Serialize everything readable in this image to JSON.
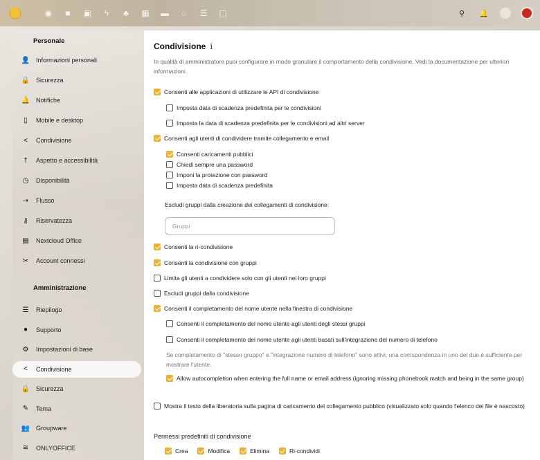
{
  "topbar": {
    "apps": [
      "dashboard-icon",
      "folder-icon",
      "photos-icon",
      "activity-icon",
      "contacts-icon",
      "calendar-icon",
      "mail-icon",
      "talk-icon",
      "tasks-icon",
      "notes-icon"
    ],
    "right": [
      "search-icon",
      "notifications-icon",
      "contacts-menu-icon",
      "user-avatar"
    ]
  },
  "sidebar": {
    "personal_heading": "Personale",
    "personal": [
      {
        "label": "Informazioni personali",
        "icon": "user-icon",
        "glyph": "👤"
      },
      {
        "label": "Sicurezza",
        "icon": "lock-icon",
        "glyph": "🔒"
      },
      {
        "label": "Notifiche",
        "icon": "bell-icon",
        "glyph": "🔔"
      },
      {
        "label": "Mobile e desktop",
        "icon": "phone-icon",
        "glyph": "▯"
      },
      {
        "label": "Condivisione",
        "icon": "share-icon",
        "glyph": "<"
      },
      {
        "label": "Aspetto e accessibilità",
        "icon": "accessibility-icon",
        "glyph": "†"
      },
      {
        "label": "Disponibilità",
        "icon": "clock-icon",
        "glyph": "◷"
      },
      {
        "label": "Flusso",
        "icon": "flow-icon",
        "glyph": "⇢"
      },
      {
        "label": "Riservatezza",
        "icon": "key-icon",
        "glyph": "⚷"
      },
      {
        "label": "Nextcloud Office",
        "icon": "office-icon",
        "glyph": "▤"
      },
      {
        "label": "Account connessi",
        "icon": "connected-icon",
        "glyph": "✂"
      }
    ],
    "admin_heading": "Amministrazione",
    "admin": [
      {
        "label": "Riepilogo",
        "icon": "list-icon",
        "glyph": "☰"
      },
      {
        "label": "Supporto",
        "icon": "support-icon",
        "glyph": "●"
      },
      {
        "label": "Impostazioni di base",
        "icon": "gear-icon",
        "glyph": "⚙"
      },
      {
        "label": "Condivisione",
        "icon": "share-icon",
        "glyph": "<",
        "active": true
      },
      {
        "label": "Sicurezza",
        "icon": "lock-icon",
        "glyph": "🔒"
      },
      {
        "label": "Tema",
        "icon": "brush-icon",
        "glyph": "✎"
      },
      {
        "label": "Groupware",
        "icon": "group-icon",
        "glyph": "👥"
      },
      {
        "label": "ONLYOFFICE",
        "icon": "onlyoffice-icon",
        "glyph": "≋"
      }
    ]
  },
  "main": {
    "title": "Condivisione",
    "info_glyph": "i",
    "description": "In qualità di amministratore puoi configurare in modo granulare il comportamento della condivisione. Vedi la documentazione per ulteriori informazioni.",
    "options": {
      "api": "Consenti alle applicazioni di utilizzare le API di condivisione",
      "default_expire": "Imposta data di scadenza predefinita per le condivisioni",
      "remote_expire": "Imposta la data di scadenza predefinita per le condivisioni ad altri server",
      "links": "Consenti agli utenti di condividere tramite collegamento e email",
      "public_upload": "Consenti caricamenti pubblici",
      "ask_password": "Chiedi sempre una password",
      "enforce_password": "Imponi la protezione con password",
      "link_expire": "Imposta data di scadenza predefinita",
      "exclude_groups_label": "Escludi gruppi dalla creazione dei collegamenti di condivisione:",
      "groups_placeholder": "Gruppi",
      "reshare": "Consenti la ri-condivisione",
      "group_share": "Consenti la condivisione con gruppi",
      "restrict_groups": "Limita gli utenti a condividere solo con gli utenti nei loro gruppi",
      "exclude_groups": "Escludi gruppi dalla condivisione",
      "autocomplete": "Consenti il completamento del nome utente nella finestra di condivisione",
      "autocomplete_groups": "Consenti il completamento del nome utente agli utenti degli stessi gruppi",
      "autocomplete_phone": "Consenti il completamento del nome utente agli utenti basati sull'integrazione del numero di telefono",
      "autocomplete_note": "Se completamento di \"stesso gruppo\" e \"integrazione numero di telefono\" sono attivi, una corrispondenza in uno dei due è sufficiente per mostrare l'utente.",
      "full_match": "Allow autocompletion when entering the full name or email address (ignoring missing phonebook match and being in the same group)",
      "disclaimer": "Mostra il testo della liberatoria sulla pagina di caricamento del collegamento pubblico (visualizzato solo quando l'elenco dei file è nascosto)"
    },
    "permissions_heading": "Permessi predefiniti di condivisione",
    "permissions": [
      "Crea",
      "Modifica",
      "Elimina",
      "Ri-condividi"
    ]
  }
}
